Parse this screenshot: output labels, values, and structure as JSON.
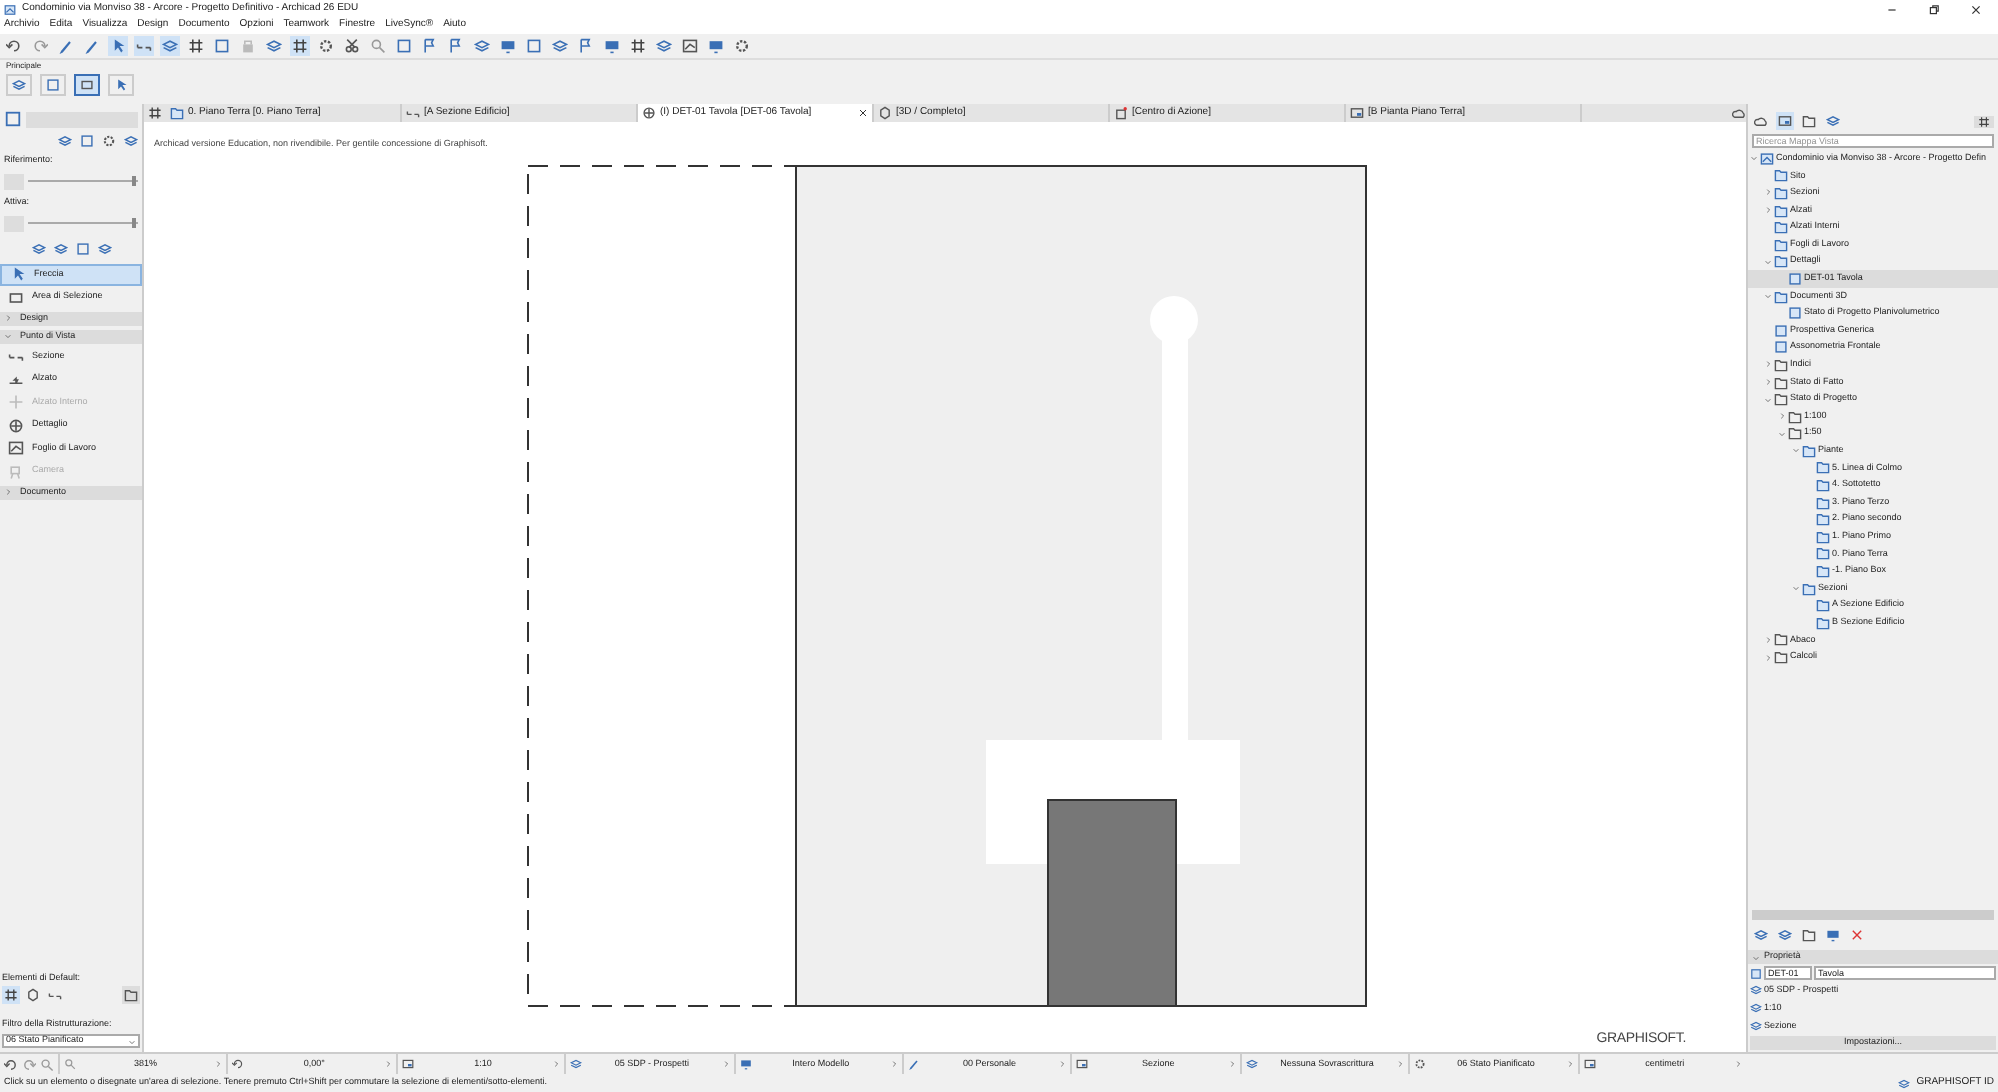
{
  "window": {
    "title": "Condominio via Monviso 38 - Arcore - Progetto Definitivo - Archicad 26 EDU"
  },
  "menu": [
    "Archivio",
    "Edita",
    "Visualizza",
    "Design",
    "Documento",
    "Opzioni",
    "Teamwork",
    "Finestre",
    "LiveSync®",
    "Aiuto"
  ],
  "toolbar_label": "Principale",
  "tabs": [
    {
      "label": "0. Piano Terra [0. Piano Terra]",
      "kind": "plan",
      "selected": false
    },
    {
      "label": "[A Sezione Edificio]",
      "kind": "section",
      "selected": false
    },
    {
      "label": "(I) DET-01 Tavola [DET-06 Tavola]",
      "kind": "detail",
      "selected": true
    },
    {
      "label": "[3D / Completo]",
      "kind": "view3d",
      "selected": false
    },
    {
      "label": "[Centro di Azione]",
      "kind": "action",
      "selected": false
    },
    {
      "label": "[B Pianta Piano Terra]",
      "kind": "layout",
      "selected": false
    }
  ],
  "toolbox": {
    "sliders": [
      {
        "label": "Riferimento:",
        "level": 0.95
      },
      {
        "label": "Attiva:",
        "level": 0.95
      }
    ],
    "items": [
      {
        "kind": "tool",
        "label": "Freccia",
        "selected": true,
        "disabled": false
      },
      {
        "kind": "tool",
        "label": "Area di Selezione",
        "selected": false,
        "disabled": false
      },
      {
        "kind": "group",
        "label": "Design",
        "expanded": false
      },
      {
        "kind": "group",
        "label": "Punto di Vista",
        "expanded": true
      },
      {
        "kind": "tool",
        "label": "Sezione",
        "selected": false,
        "disabled": false
      },
      {
        "kind": "tool",
        "label": "Alzato",
        "selected": false,
        "disabled": false
      },
      {
        "kind": "tool",
        "label": "Alzato Interno",
        "selected": false,
        "disabled": true
      },
      {
        "kind": "tool",
        "label": "Dettaglio",
        "selected": false,
        "disabled": false
      },
      {
        "kind": "tool",
        "label": "Foglio di Lavoro",
        "selected": false,
        "disabled": false
      },
      {
        "kind": "tool",
        "label": "Camera",
        "selected": false,
        "disabled": true
      },
      {
        "kind": "group",
        "label": "Documento",
        "expanded": false
      }
    ],
    "defaults_label": "Elementi di Default:",
    "renovation_label": "Filtro della Ristrutturazione:",
    "renovation_value": "06 Stato Pianificato"
  },
  "canvas": {
    "notice": "Archicad versione Education, non rivendibile. Per gentile concessione di Graphisoft.",
    "logo": "GRAPHISOFT."
  },
  "navigator": {
    "search_placeholder": "Ricerca Mappa Vista",
    "tree": [
      {
        "label": "Condominio via Monviso 38 - Arcore - Progetto Defin",
        "kind": "project",
        "expanded": true,
        "selected": false,
        "children": [
          {
            "label": "Sito",
            "kind": "viewfolder",
            "selected": false
          },
          {
            "label": "Sezioni",
            "kind": "viewfolder",
            "expanded": false,
            "selected": false
          },
          {
            "label": "Alzati",
            "kind": "viewfolder",
            "expanded": false,
            "selected": false
          },
          {
            "label": "Alzati Interni",
            "kind": "viewfolder",
            "selected": false
          },
          {
            "label": "Fogli di Lavoro",
            "kind": "viewfolder",
            "selected": false
          },
          {
            "label": "Dettagli",
            "kind": "viewfolder",
            "expanded": true,
            "selected": false,
            "children": [
              {
                "label": "DET-01 Tavola",
                "kind": "view",
                "selected": true
              }
            ]
          },
          {
            "label": "Documenti 3D",
            "kind": "viewfolder",
            "expanded": true,
            "selected": false,
            "children": [
              {
                "label": "Stato di Progetto Planivolumetrico",
                "kind": "view",
                "selected": false
              }
            ]
          },
          {
            "label": "Prospettiva Generica",
            "kind": "view",
            "selected": false
          },
          {
            "label": "Assonometria Frontale",
            "kind": "view",
            "selected": false
          },
          {
            "label": "Indici",
            "kind": "folder",
            "expanded": false,
            "selected": false
          },
          {
            "label": "Stato di Fatto",
            "kind": "folder",
            "expanded": false,
            "selected": false
          },
          {
            "label": "Stato di Progetto",
            "kind": "folder",
            "expanded": true,
            "selected": false,
            "children": [
              {
                "label": "1:100",
                "kind": "folder",
                "expanded": false,
                "selected": false
              },
              {
                "label": "1:50",
                "kind": "folder",
                "expanded": true,
                "selected": false,
                "children": [
                  {
                    "label": "Piante",
                    "kind": "viewfolder",
                    "expanded": true,
                    "selected": false,
                    "children": [
                      {
                        "label": "5. Linea di Colmo",
                        "kind": "viewfolder",
                        "selected": false
                      },
                      {
                        "label": "4. Sottotetto",
                        "kind": "viewfolder",
                        "selected": false
                      },
                      {
                        "label": "3. Piano Terzo",
                        "kind": "viewfolder",
                        "selected": false
                      },
                      {
                        "label": "2. Piano secondo",
                        "kind": "viewfolder",
                        "selected": false
                      },
                      {
                        "label": "1. Piano Primo",
                        "kind": "viewfolder",
                        "selected": false
                      },
                      {
                        "label": "0.  Piano Terra",
                        "kind": "viewfolder",
                        "selected": false
                      },
                      {
                        "label": "-1. Piano Box",
                        "kind": "viewfolder",
                        "selected": false
                      }
                    ]
                  },
                  {
                    "label": "Sezioni",
                    "kind": "viewfolder",
                    "expanded": true,
                    "selected": false,
                    "children": [
                      {
                        "label": "A Sezione Edificio",
                        "kind": "viewfolder",
                        "selected": false
                      },
                      {
                        "label": "B Sezione Edificio",
                        "kind": "viewfolder",
                        "selected": false
                      }
                    ]
                  }
                ]
              }
            ]
          },
          {
            "label": "Abaco",
            "kind": "folder",
            "expanded": false,
            "selected": false
          },
          {
            "label": "Calcoli",
            "kind": "folder",
            "expanded": false,
            "selected": false
          }
        ]
      }
    ]
  },
  "properties": {
    "title": "Proprietà",
    "expanded": true,
    "id": "DET-01",
    "name": "Tavola",
    "rows": [
      "05 SDP - Prospetti",
      "1:10",
      "Sezione"
    ],
    "button": "Impostazioni..."
  },
  "status_bar": {
    "fields": [
      "381%",
      "0,00°",
      "1:10",
      "05 SDP - Prospetti",
      "Intero Modello",
      "00 Personale",
      "Sezione",
      "Nessuna Sovrascrittura",
      "06 Stato Pianificato",
      "centimetri"
    ],
    "message": "Click su un elemento o disegnate un'area di selezione. Tenere premuto Ctrl+Shift per commutare la selezione di elementi/sotto-elementi.",
    "account": "GRAPHISOFT ID"
  }
}
